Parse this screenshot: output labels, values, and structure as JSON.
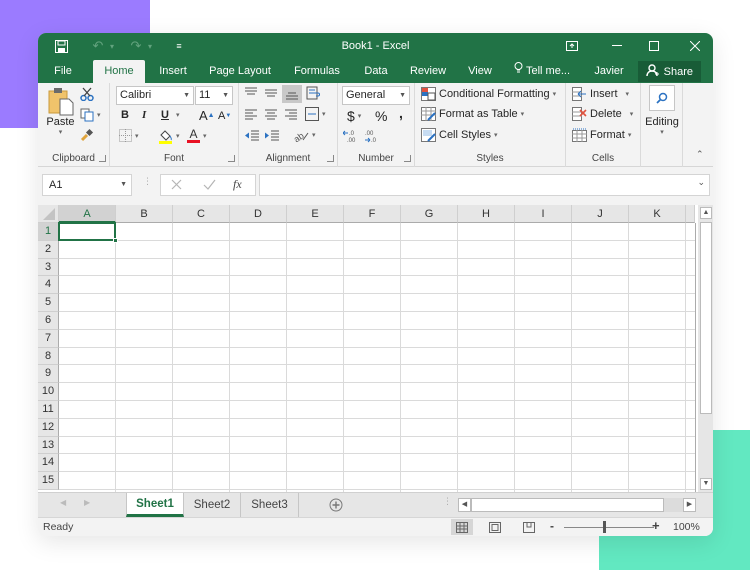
{
  "window": {
    "title": "Book1 - Excel",
    "user": "Javier Flores",
    "share_label": "Share",
    "tell_me": "Tell me...",
    "colors": {
      "brand": "#217346",
      "brand_dark": "#185c37",
      "accent_purple": "#9b7bff",
      "accent_teal": "#62e8c1"
    }
  },
  "tabs": [
    {
      "label": "File"
    },
    {
      "label": "Home",
      "active": true
    },
    {
      "label": "Insert"
    },
    {
      "label": "Page Layout"
    },
    {
      "label": "Formulas"
    },
    {
      "label": "Data"
    },
    {
      "label": "Review"
    },
    {
      "label": "View"
    }
  ],
  "ribbon": {
    "clipboard": {
      "label": "Clipboard",
      "paste": "Paste"
    },
    "font": {
      "label": "Font",
      "font_name": "Calibri",
      "font_size": "11",
      "bold": "B",
      "italic": "I",
      "underline": "U",
      "grow": "A",
      "shrink": "A",
      "font_color": "A"
    },
    "alignment": {
      "label": "Alignment"
    },
    "number": {
      "label": "Number",
      "format": "General",
      "currency": "$",
      "percent": "%",
      "comma": ","
    },
    "styles": {
      "label": "Styles",
      "conditional": "Conditional Formatting",
      "format_table": "Format as Table",
      "cell_styles": "Cell Styles"
    },
    "cells": {
      "label": "Cells",
      "insert": "Insert",
      "delete": "Delete",
      "format": "Format"
    },
    "editing": {
      "label": "Editing"
    }
  },
  "formula_bar": {
    "name_box": "A1",
    "formula": "",
    "fx": "fx"
  },
  "grid": {
    "columns": [
      "A",
      "B",
      "C",
      "D",
      "E",
      "F",
      "G",
      "H",
      "I",
      "J",
      "K"
    ],
    "rows": [
      "1",
      "2",
      "3",
      "4",
      "5",
      "6",
      "7",
      "8",
      "9",
      "10",
      "11",
      "12",
      "13",
      "14",
      "15"
    ],
    "active_cell": "A1"
  },
  "sheets": [
    {
      "label": "Sheet1",
      "active": true
    },
    {
      "label": "Sheet2"
    },
    {
      "label": "Sheet3"
    }
  ],
  "status": {
    "text": "Ready",
    "zoom": "100%",
    "zoom_minus": "-",
    "zoom_plus": "+"
  }
}
